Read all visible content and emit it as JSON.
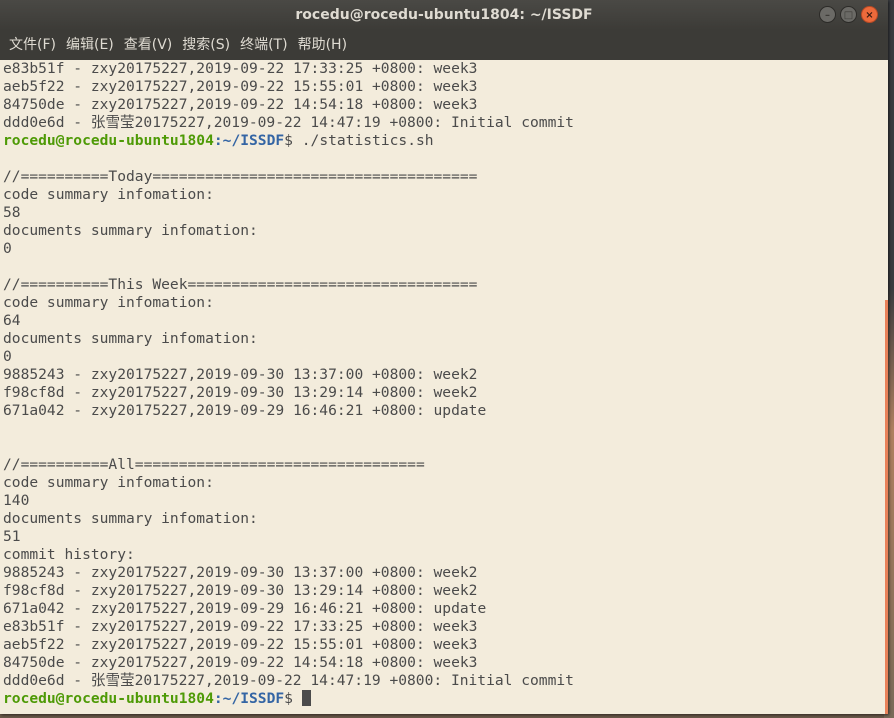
{
  "window": {
    "title": "rocedu@rocedu-ubuntu1804: ~/ISSDF",
    "buttons": {
      "minimize": "–",
      "maximize": "□",
      "close": "×"
    }
  },
  "menu": [
    "文件(F)",
    "编辑(E)",
    "查看(V)",
    "搜索(S)",
    "终端(T)",
    "帮助(H)"
  ],
  "prompt": {
    "user": "rocedu@rocedu-ubuntu1804",
    "path": ":~/ISSDF",
    "symbol": "$",
    "command1": " ./statistics.sh"
  },
  "lines_top": [
    "e83b51f - zxy20175227,2019-09-22 17:33:25 +0800: week3",
    "aeb5f22 - zxy20175227,2019-09-22 15:55:01 +0800: week3",
    "84750de - zxy20175227,2019-09-22 14:54:18 +0800: week3",
    "ddd0e6d - 张雪莹20175227,2019-09-22 14:47:19 +0800: Initial commit"
  ],
  "lines_output": [
    "",
    "//==========Today=====================================",
    "code summary infomation:",
    "58",
    "documents summary infomation:",
    "0",
    "",
    "//==========This Week=================================",
    "code summary infomation:",
    "64",
    "documents summary infomation:",
    "0",
    "9885243 - zxy20175227,2019-09-30 13:37:00 +0800: week2",
    "f98cf8d - zxy20175227,2019-09-30 13:29:14 +0800: week2",
    "671a042 - zxy20175227,2019-09-29 16:46:21 +0800: update",
    "",
    "",
    "//==========All=================================",
    "code summary infomation:",
    "140",
    "documents summary infomation:",
    "51",
    "commit history:",
    "9885243 - zxy20175227,2019-09-30 13:37:00 +0800: week2",
    "f98cf8d - zxy20175227,2019-09-30 13:29:14 +0800: week2",
    "671a042 - zxy20175227,2019-09-29 16:46:21 +0800: update",
    "e83b51f - zxy20175227,2019-09-22 17:33:25 +0800: week3",
    "aeb5f22 - zxy20175227,2019-09-22 15:55:01 +0800: week3",
    "84750de - zxy20175227,2019-09-22 14:54:18 +0800: week3",
    "ddd0e6d - 张雪莹20175227,2019-09-22 14:47:19 +0800: Initial commit"
  ],
  "colors": {
    "terminal_bg": "#f3ecdc",
    "prompt_user": "#4e9a06",
    "prompt_path": "#3465a4",
    "scroll_thumb": "#e9825a",
    "close_button": "#ec6a3b"
  }
}
